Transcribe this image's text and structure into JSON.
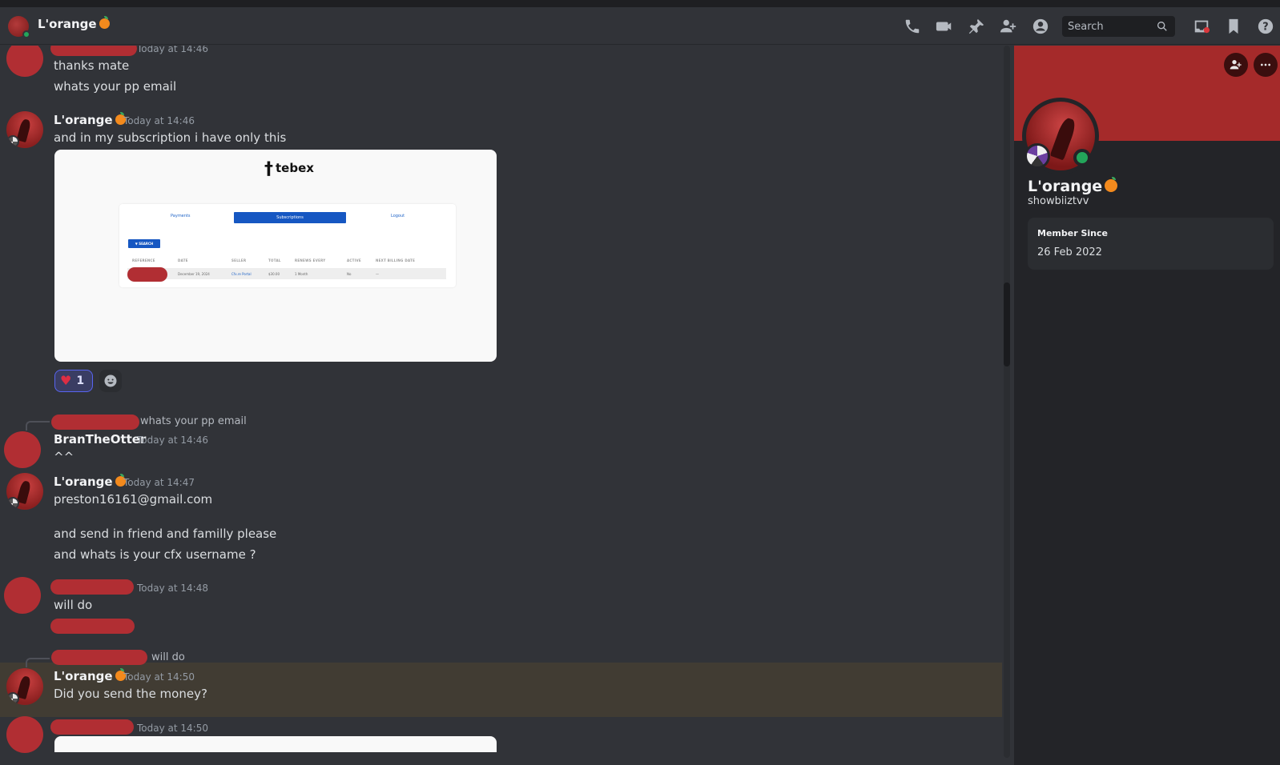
{
  "header": {
    "title": "L'orange",
    "search_placeholder": "Search"
  },
  "messages": [
    {
      "author": "",
      "timestamp": "Today at 14:46",
      "lines": [
        "thanks mate",
        "whats your pp email"
      ]
    },
    {
      "author": "L'orange",
      "timestamp": "Today at 14:46",
      "lines": [
        "and in my subscription i have only this"
      ]
    },
    {
      "author": "BranTheOtter",
      "timestamp": "Today at 14:46",
      "reply_to_text": "whats your pp email",
      "lines": [
        "^^"
      ]
    },
    {
      "author": "L'orange",
      "timestamp": "Today at 14:47",
      "lines": [
        "preston16161@gmail.com",
        "and send in friend and familly please",
        "and whats is your cfx username ?"
      ]
    },
    {
      "author": "",
      "timestamp": "Today at 14:48",
      "lines": [
        "will do"
      ]
    },
    {
      "author": "L'orange",
      "timestamp": "Today at 14:50",
      "reply_to_text": "will do",
      "lines": [
        "Did you send the money?"
      ]
    },
    {
      "author": "",
      "timestamp": "Today at 14:50",
      "lines": []
    }
  ],
  "embed": {
    "logo": "tebex",
    "nav": [
      "Payments",
      "Subscriptions",
      "Logout"
    ],
    "search_button": "SEARCH",
    "columns": [
      "REFERENCE",
      "DATE",
      "SELLER",
      "TOTAL",
      "RENEWS EVERY",
      "ACTIVE",
      "NEXT BILLING DATE"
    ],
    "row": {
      "date": "December 19, 2024",
      "seller": "Cfx.re Portal",
      "total": "$30.00",
      "renews": "1 Month",
      "active": "No",
      "next": "—"
    }
  },
  "reaction": {
    "emoji": "heart",
    "count": "1"
  },
  "profile": {
    "display_name": "L'orange",
    "username": "showbiiztvv",
    "member_since_label": "Member Since",
    "member_since_value": "26 Feb 2022"
  },
  "colors": {
    "accent_red": "#b12e33",
    "online": "#23a55a",
    "background": "#313338",
    "sidebar": "#232428"
  }
}
